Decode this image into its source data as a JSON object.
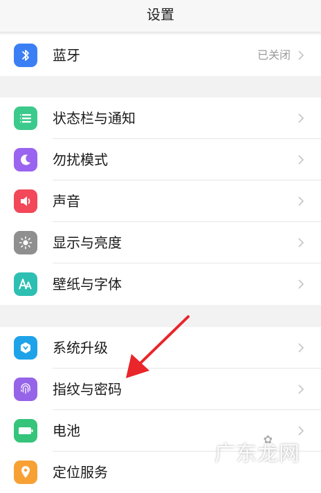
{
  "header": {
    "title": "设置"
  },
  "groups": [
    {
      "items": [
        {
          "label": "蓝牙",
          "value": "已关闭",
          "icon": "bluetooth-icon",
          "color": "#3b7ff5"
        }
      ]
    },
    {
      "items": [
        {
          "label": "状态栏与通知",
          "icon": "notification-bar-icon",
          "color": "#3cc98c"
        },
        {
          "label": "勿扰模式",
          "icon": "moon-icon",
          "color": "#9a64f0"
        },
        {
          "label": "声音",
          "icon": "speaker-icon",
          "color": "#f2485a"
        },
        {
          "label": "显示与亮度",
          "icon": "sun-icon",
          "color": "#8f8f8f"
        },
        {
          "label": "壁纸与字体",
          "icon": "font-icon",
          "color": "#2ebfb3"
        }
      ]
    },
    {
      "items": [
        {
          "label": "系统升级",
          "icon": "update-icon",
          "color": "#1ea3e8"
        },
        {
          "label": "指纹与密码",
          "icon": "fingerprint-icon",
          "color": "#9564e8"
        },
        {
          "label": "电池",
          "icon": "battery-icon",
          "color": "#35c47a"
        },
        {
          "label": "定位服务",
          "icon": "location-icon",
          "color": "#f7a135"
        }
      ]
    }
  ],
  "watermark": {
    "text": "广东龙网"
  },
  "accent": {
    "arrow": "#e8262b"
  }
}
